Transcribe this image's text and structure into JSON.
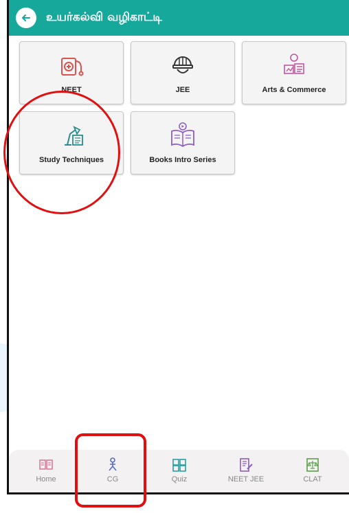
{
  "appbar": {
    "title": "உயர்கல்வி வழிகாட்டி",
    "back_icon": "arrow-left-icon",
    "color": "#16a89a"
  },
  "cards": [
    {
      "label": "NEET",
      "icon": "medical-stethoscope-icon"
    },
    {
      "label": "JEE",
      "icon": "engineer-helmet-icon"
    },
    {
      "label": "Arts & Commerce",
      "icon": "arts-commerce-icon"
    },
    {
      "label": "Study Techniques",
      "icon": "study-lamp-book-icon"
    },
    {
      "label": "Books Intro Series",
      "icon": "open-book-play-icon"
    }
  ],
  "bottom_nav": [
    {
      "label": "Home",
      "icon": "home-book-icon"
    },
    {
      "label": "CG",
      "icon": "career-guide-icon"
    },
    {
      "label": "Quiz",
      "icon": "puzzle-icon"
    },
    {
      "label": "NEET JEE",
      "icon": "notebook-pen-icon"
    },
    {
      "label": "CLAT",
      "icon": "law-scale-icon"
    }
  ],
  "annotation_color": "#e01010"
}
